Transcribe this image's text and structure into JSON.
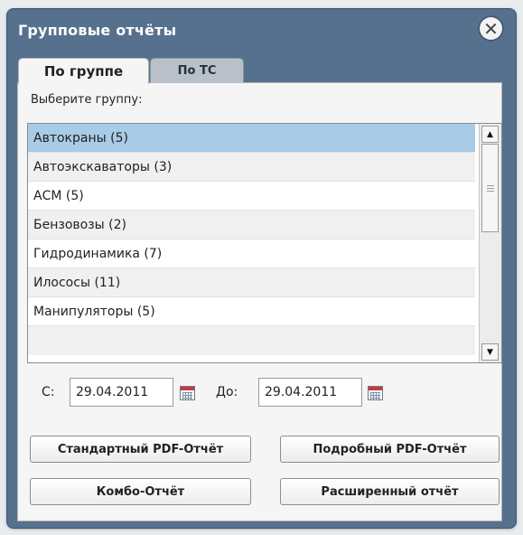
{
  "dialog": {
    "title": "Групповые отчёты",
    "close_icon": "close-icon"
  },
  "tabs": [
    {
      "label": "По группе",
      "active": true
    },
    {
      "label": "По ТС",
      "active": false
    }
  ],
  "prompt": "Выберите группу:",
  "groups": [
    "Автокраны (5)",
    "Автоэкскаваторы (3)",
    "АСМ (5)",
    "Бензовозы (2)",
    "Гидродинамика (7)",
    "Илососы (11)",
    "Манипуляторы (5)"
  ],
  "selected_group": "Автокраны (5)",
  "dates": {
    "from_label": "С:",
    "from_value": "29.04.2011",
    "to_label": "До:",
    "to_value": "29.04.2011"
  },
  "buttons": {
    "standard_pdf": "Стандартный PDF-Отчёт",
    "detailed_pdf": "Подробный PDF-Отчёт",
    "combo": "Комбо-Отчёт",
    "extended": "Расширенный отчёт"
  },
  "colors": {
    "header": "#55718e",
    "selected_row": "#a8cbe6",
    "inactive_tab": "#b9c0c8"
  }
}
